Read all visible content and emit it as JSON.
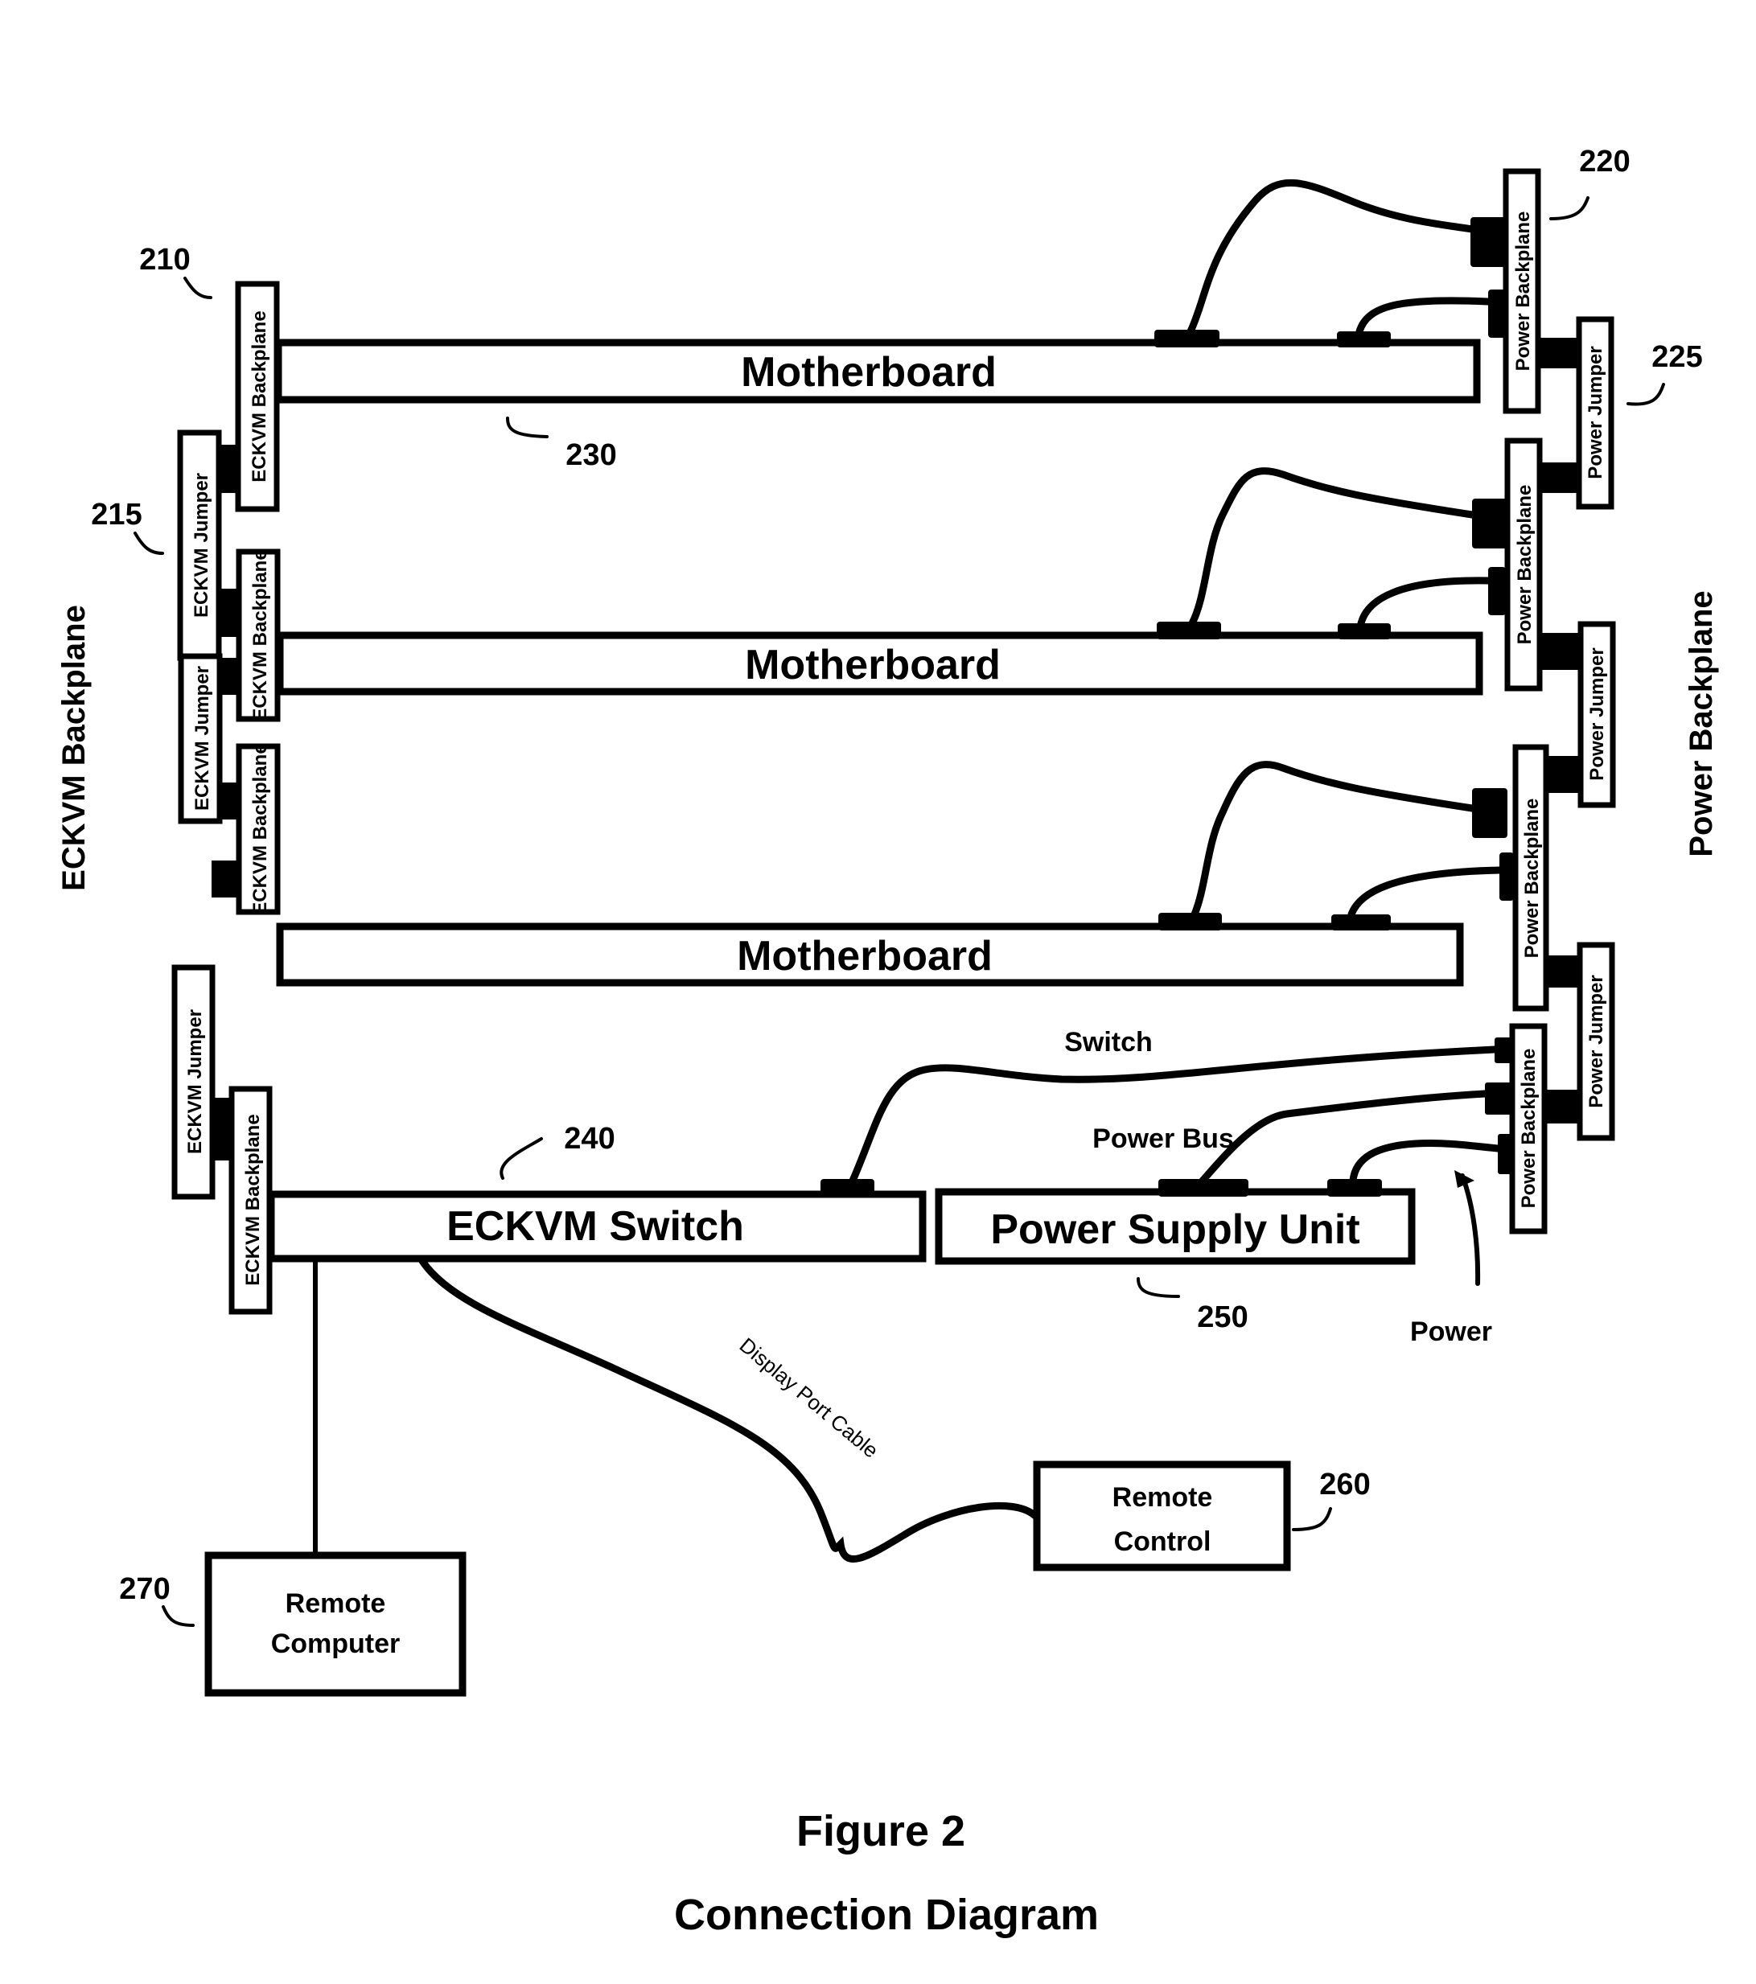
{
  "figure": {
    "title": "Figure 2",
    "subtitle": "Connection Diagram"
  },
  "side_labels": {
    "left": "ECKVM Backplane",
    "right": "Power Backplane"
  },
  "eckvm_backplanes": [
    {
      "label": "ECKVM Backplane"
    },
    {
      "label": "ECKVM Backplane"
    },
    {
      "label": "ECKVM Backplane"
    },
    {
      "label": "ECKVM Backplane"
    }
  ],
  "eckvm_jumpers": [
    {
      "label": "ECKVM Jumper"
    },
    {
      "label": "ECKVM Jumper"
    },
    {
      "label": "ECKVM Jumper"
    }
  ],
  "power_backplanes": [
    {
      "label": "Power Backplane"
    },
    {
      "label": "Power Backplane"
    },
    {
      "label": "Power Backplane"
    },
    {
      "label": "Power Backplane"
    }
  ],
  "power_jumpers": [
    {
      "label": "Power Jumper"
    },
    {
      "label": "Power Jumper"
    },
    {
      "label": "Power Jumper"
    }
  ],
  "motherboards": [
    {
      "label": "Motherboard"
    },
    {
      "label": "Motherboard"
    },
    {
      "label": "Motherboard"
    }
  ],
  "eckvm_switch": {
    "label": "ECKVM Switch"
  },
  "power_supply": {
    "label": "Power Supply Unit"
  },
  "remote_control": {
    "line1": "Remote",
    "line2": "Control"
  },
  "remote_computer": {
    "line1": "Remote",
    "line2": "Computer"
  },
  "cable_labels": {
    "switch": "Switch",
    "power_bus": "Power Bus",
    "power": "Power",
    "display_port": "Display Port Cable"
  },
  "reference_numerals": {
    "eckvm_backplane": "210",
    "eckvm_jumper": "215",
    "power_backplane": "220",
    "power_jumper": "225",
    "motherboard": "230",
    "eckvm_switch": "240",
    "power_supply_unit": "250",
    "remote_control": "260",
    "remote_computer": "270"
  }
}
